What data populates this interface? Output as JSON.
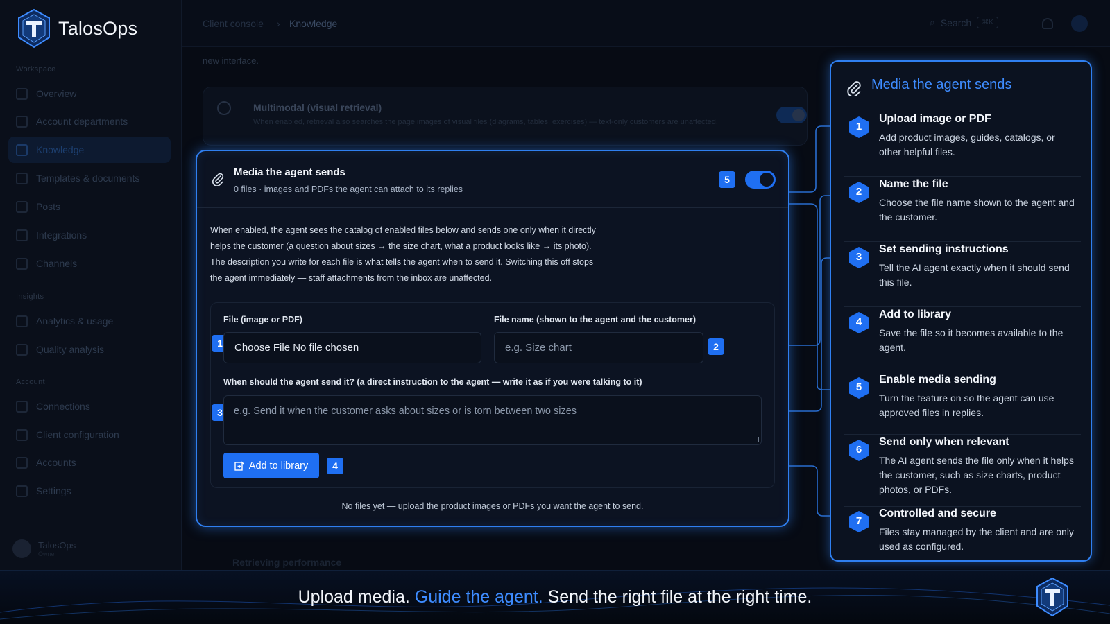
{
  "brand": {
    "name": "TalosOps"
  },
  "sidebar": {
    "sections": [
      {
        "label": "Workspace"
      },
      {
        "label": "Insights"
      },
      {
        "label": "Account"
      }
    ],
    "items": [
      {
        "label": "Overview"
      },
      {
        "label": "Account departments"
      },
      {
        "label": "Knowledge"
      },
      {
        "label": "Templates & documents"
      },
      {
        "label": "Posts"
      },
      {
        "label": "Integrations"
      },
      {
        "label": "Channels"
      },
      {
        "label": "Analytics & usage"
      },
      {
        "label": "Quality analysis"
      },
      {
        "label": "Connections"
      },
      {
        "label": "Client configuration"
      },
      {
        "label": "Accounts"
      },
      {
        "label": "Settings"
      }
    ],
    "user": {
      "name": "TalosOps",
      "role": "Owner"
    }
  },
  "topbar": {
    "breadcrumb": [
      "Client console",
      "Knowledge"
    ],
    "search_label": "Search",
    "search_shortcut": "⌘K"
  },
  "background": {
    "intro_text": "new interface.",
    "multimodal_title": "Multimodal (visual retrieval)",
    "multimodal_desc": "When enabled, retrieval also searches the page images of visual files (diagrams, tables, exercises) — text-only customers are unaffected.",
    "next_card_title": "Retrieving performance"
  },
  "card": {
    "title": "Media the agent sends",
    "subtitle": "0 files · images and PDFs the agent can attach to its replies",
    "toggle_on": true,
    "description": "When enabled, the agent sees the catalog of enabled files below and sends one only when it directly helps the customer (a question about sizes → the size chart, what a product looks like → its photo). The description you write for each file is what tells the agent when to send it. Switching this off stops the agent immediately — staff attachments from the inbox are unaffected.",
    "file_label": "File (image or PDF)",
    "file_value": "Choose File No file chosen",
    "name_label": "File name (shown to the agent and the customer)",
    "name_placeholder": "e.g. Size chart",
    "instruction_label": "When should the agent send it? (a direct instruction to the agent — write it as if you were talking to it)",
    "instruction_placeholder": "e.g. Send it when the customer asks about sizes or is torn between two sizes",
    "add_button": "Add to library",
    "empty_text": "No files yet — upload the product images or PDFs you want the agent to send."
  },
  "badges": {
    "b1": "1",
    "b2": "2",
    "b3": "3",
    "b4": "4",
    "b5": "5"
  },
  "panel": {
    "title": "Media the agent sends",
    "steps": [
      {
        "num": "1",
        "title": "Upload image or PDF",
        "desc": "Add product images, guides, catalogs, or other helpful files."
      },
      {
        "num": "2",
        "title": "Name the file",
        "desc": "Choose the file name shown to the agent and the customer."
      },
      {
        "num": "3",
        "title": "Set sending instructions",
        "desc": "Tell the AI agent exactly when it should send this file."
      },
      {
        "num": "4",
        "title": "Add to library",
        "desc": "Save the file so it becomes available to the agent."
      },
      {
        "num": "5",
        "title": "Enable media sending",
        "desc": "Turn the feature on so the agent can use approved files in replies."
      },
      {
        "num": "6",
        "title": "Send only when relevant",
        "desc": "The AI agent sends the file only when it helps the customer, such as size charts, product photos, or PDFs."
      },
      {
        "num": "7",
        "title": "Controlled and secure",
        "desc": "Files stay managed by the client and are only used as configured."
      }
    ]
  },
  "banner": {
    "part1": "Upload media.",
    "part2": "Guide the agent.",
    "part3": "Send the right file at the right time."
  },
  "colors": {
    "accent": "#1f6ff2",
    "accent_text": "#3e8cff",
    "background": "#070b14"
  }
}
